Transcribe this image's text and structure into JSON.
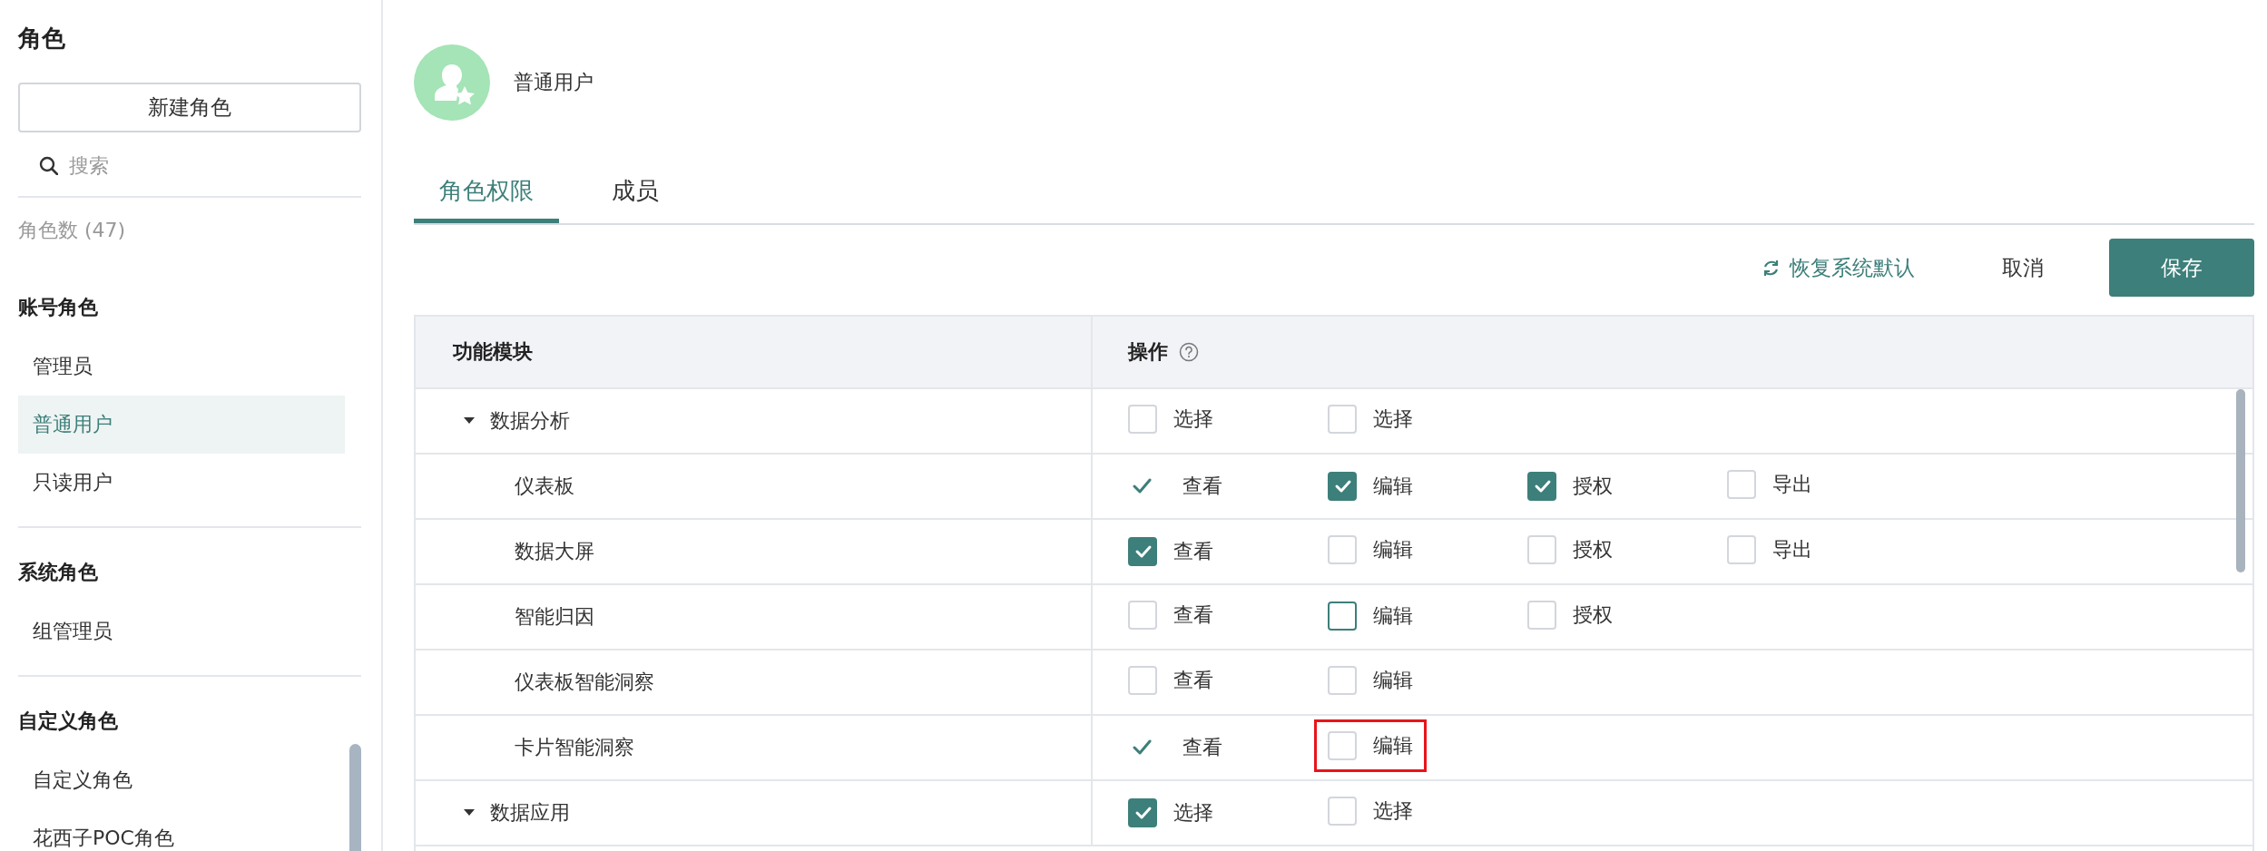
{
  "sidebar": {
    "title": "角色",
    "new_button": "新建角色",
    "search": {
      "placeholder": "搜索"
    },
    "count": "角色数 (47)",
    "groups": [
      {
        "title": "账号角色",
        "items": [
          {
            "label": "管理员",
            "selected": false
          },
          {
            "label": "普通用户",
            "selected": true
          },
          {
            "label": "只读用户",
            "selected": false
          }
        ]
      },
      {
        "title": "系统角色",
        "items": [
          {
            "label": "组管理员",
            "selected": false
          }
        ]
      },
      {
        "title": "自定义角色",
        "items": [
          {
            "label": "自定义角色",
            "selected": false
          },
          {
            "label": "花西子POC角色",
            "selected": false
          }
        ]
      }
    ]
  },
  "role": {
    "name": "普通用户"
  },
  "tabs": [
    {
      "label": "角色权限",
      "selected": true
    },
    {
      "label": "成员",
      "selected": false
    }
  ],
  "toolbar": {
    "restore": "恢复系统默认",
    "cancel": "取消",
    "save": "保存"
  },
  "table": {
    "columns": [
      "功能模块",
      "操作"
    ],
    "rows": [
      {
        "label": "数据分析",
        "expanded": true,
        "actions": [
          {
            "kind": "checkbox",
            "label": "选择",
            "checked": false,
            "focused": false,
            "highlighted": false
          },
          {
            "kind": "checkbox",
            "label": "选择",
            "checked": false,
            "focused": false,
            "highlighted": false
          }
        ],
        "children": [
          {
            "label": "仪表板",
            "actions": [
              {
                "kind": "tick",
                "label": "查看",
                "checked": true,
                "highlighted": false
              },
              {
                "kind": "checkbox",
                "label": "编辑",
                "checked": true,
                "focused": false,
                "highlighted": false
              },
              {
                "kind": "checkbox",
                "label": "授权",
                "checked": true,
                "focused": false,
                "highlighted": false
              },
              {
                "kind": "checkbox",
                "label": "导出",
                "checked": false,
                "focused": false,
                "highlighted": false
              }
            ]
          },
          {
            "label": "数据大屏",
            "actions": [
              {
                "kind": "checkbox",
                "label": "查看",
                "checked": true,
                "focused": false,
                "highlighted": false
              },
              {
                "kind": "checkbox",
                "label": "编辑",
                "checked": false,
                "focused": false,
                "highlighted": false
              },
              {
                "kind": "checkbox",
                "label": "授权",
                "checked": false,
                "focused": false,
                "highlighted": false
              },
              {
                "kind": "checkbox",
                "label": "导出",
                "checked": false,
                "focused": false,
                "highlighted": false
              }
            ]
          },
          {
            "label": "智能归因",
            "actions": [
              {
                "kind": "checkbox",
                "label": "查看",
                "checked": false,
                "focused": false,
                "highlighted": false
              },
              {
                "kind": "checkbox",
                "label": "编辑",
                "checked": false,
                "focused": true,
                "highlighted": false
              },
              {
                "kind": "checkbox",
                "label": "授权",
                "checked": false,
                "focused": false,
                "highlighted": false
              }
            ]
          },
          {
            "label": "仪表板智能洞察",
            "actions": [
              {
                "kind": "checkbox",
                "label": "查看",
                "checked": false,
                "focused": false,
                "highlighted": false
              },
              {
                "kind": "checkbox",
                "label": "编辑",
                "checked": false,
                "focused": false,
                "highlighted": false
              }
            ]
          },
          {
            "label": "卡片智能洞察",
            "actions": [
              {
                "kind": "tick",
                "label": "查看",
                "checked": true,
                "highlighted": false
              },
              {
                "kind": "checkbox",
                "label": "编辑",
                "checked": false,
                "focused": false,
                "highlighted": true
              }
            ]
          }
        ]
      },
      {
        "label": "数据应用",
        "expanded": true,
        "actions": [
          {
            "kind": "checkbox",
            "label": "选择",
            "checked": true,
            "focused": false,
            "highlighted": false
          },
          {
            "kind": "checkbox",
            "label": "选择",
            "checked": false,
            "focused": false,
            "highlighted": false
          }
        ]
      }
    ]
  }
}
